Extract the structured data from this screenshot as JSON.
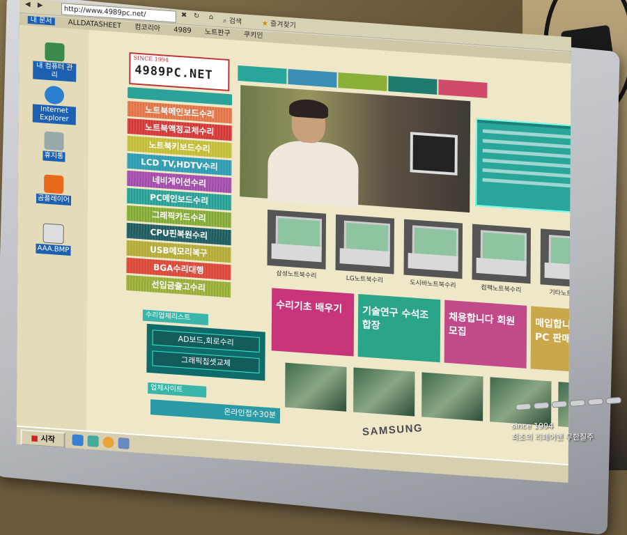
{
  "browser": {
    "address": "http://www.4989pc.net/",
    "toolbar_search": "검색",
    "toolbar_favorites": "즐겨찾기"
  },
  "links_bar": {
    "label": "내 문서",
    "items": [
      "ALLDATASHEET",
      "컴코리아",
      "4989",
      "노트판구",
      "쿠키인"
    ]
  },
  "desktop_icons": [
    {
      "label": "내 컴퓨터 관리"
    },
    {
      "label": "Internet Explorer"
    },
    {
      "label": "휴지통"
    },
    {
      "label": "곰플레이어"
    },
    {
      "label": "AAA.BMP"
    }
  ],
  "site": {
    "logo_since": "SINCE 1994",
    "logo_name": "4989PC.NET",
    "menu_items": [
      {
        "label": "노트북메인보드수리",
        "color": "#e8784a"
      },
      {
        "label": "노트북액정교체수리",
        "color": "#d93a3a"
      },
      {
        "label": "노트북키보드수리",
        "color": "#c9c23a"
      },
      {
        "label": "LCD TV,HDTV수리",
        "color": "#2e9fb8"
      },
      {
        "label": "네비게이션수리",
        "color": "#a64fb0"
      },
      {
        "label": "PC메인보드수리",
        "color": "#2aa59a"
      },
      {
        "label": "그래픽카드수리",
        "color": "#8ab03a"
      },
      {
        "label": "CPU핀복원수리",
        "color": "#1f5e63"
      },
      {
        "label": "USB메모리복구",
        "color": "#b9b03a"
      },
      {
        "label": "BGA수리대행",
        "color": "#e04a3a"
      },
      {
        "label": "선입금출고수리",
        "color": "#9cb33a"
      }
    ],
    "sub_heading": "수리업체리스트",
    "sub_items": [
      "AD보드,회로수리",
      "그래픽칩셋교체"
    ],
    "sub_heading2": "업체사이트",
    "sub_bar": "온라인접수30분",
    "thumb_captions": [
      "삼성노트북수리",
      "LG노트북수리",
      "도시바노트북수리",
      "컴팩노트북수리",
      "기타노트북수리"
    ],
    "banners": [
      {
        "label": "수리기초 배우기",
        "color": "#c8347a"
      },
      {
        "label": "기술연구 수석조합장",
        "color": "#2aa58a"
      },
      {
        "label": "채용합니다 회원모집",
        "color": "#c24a8a"
      },
      {
        "label": "매입합니다 중고PC 판매",
        "color": "#c8a84a"
      }
    ]
  },
  "taskbar": {
    "start_label": "시작"
  },
  "monitor_brand": "SAMSUNG",
  "caption": {
    "line1": "since 1994",
    "line2": "최초의 리페어맨 무한질주"
  }
}
